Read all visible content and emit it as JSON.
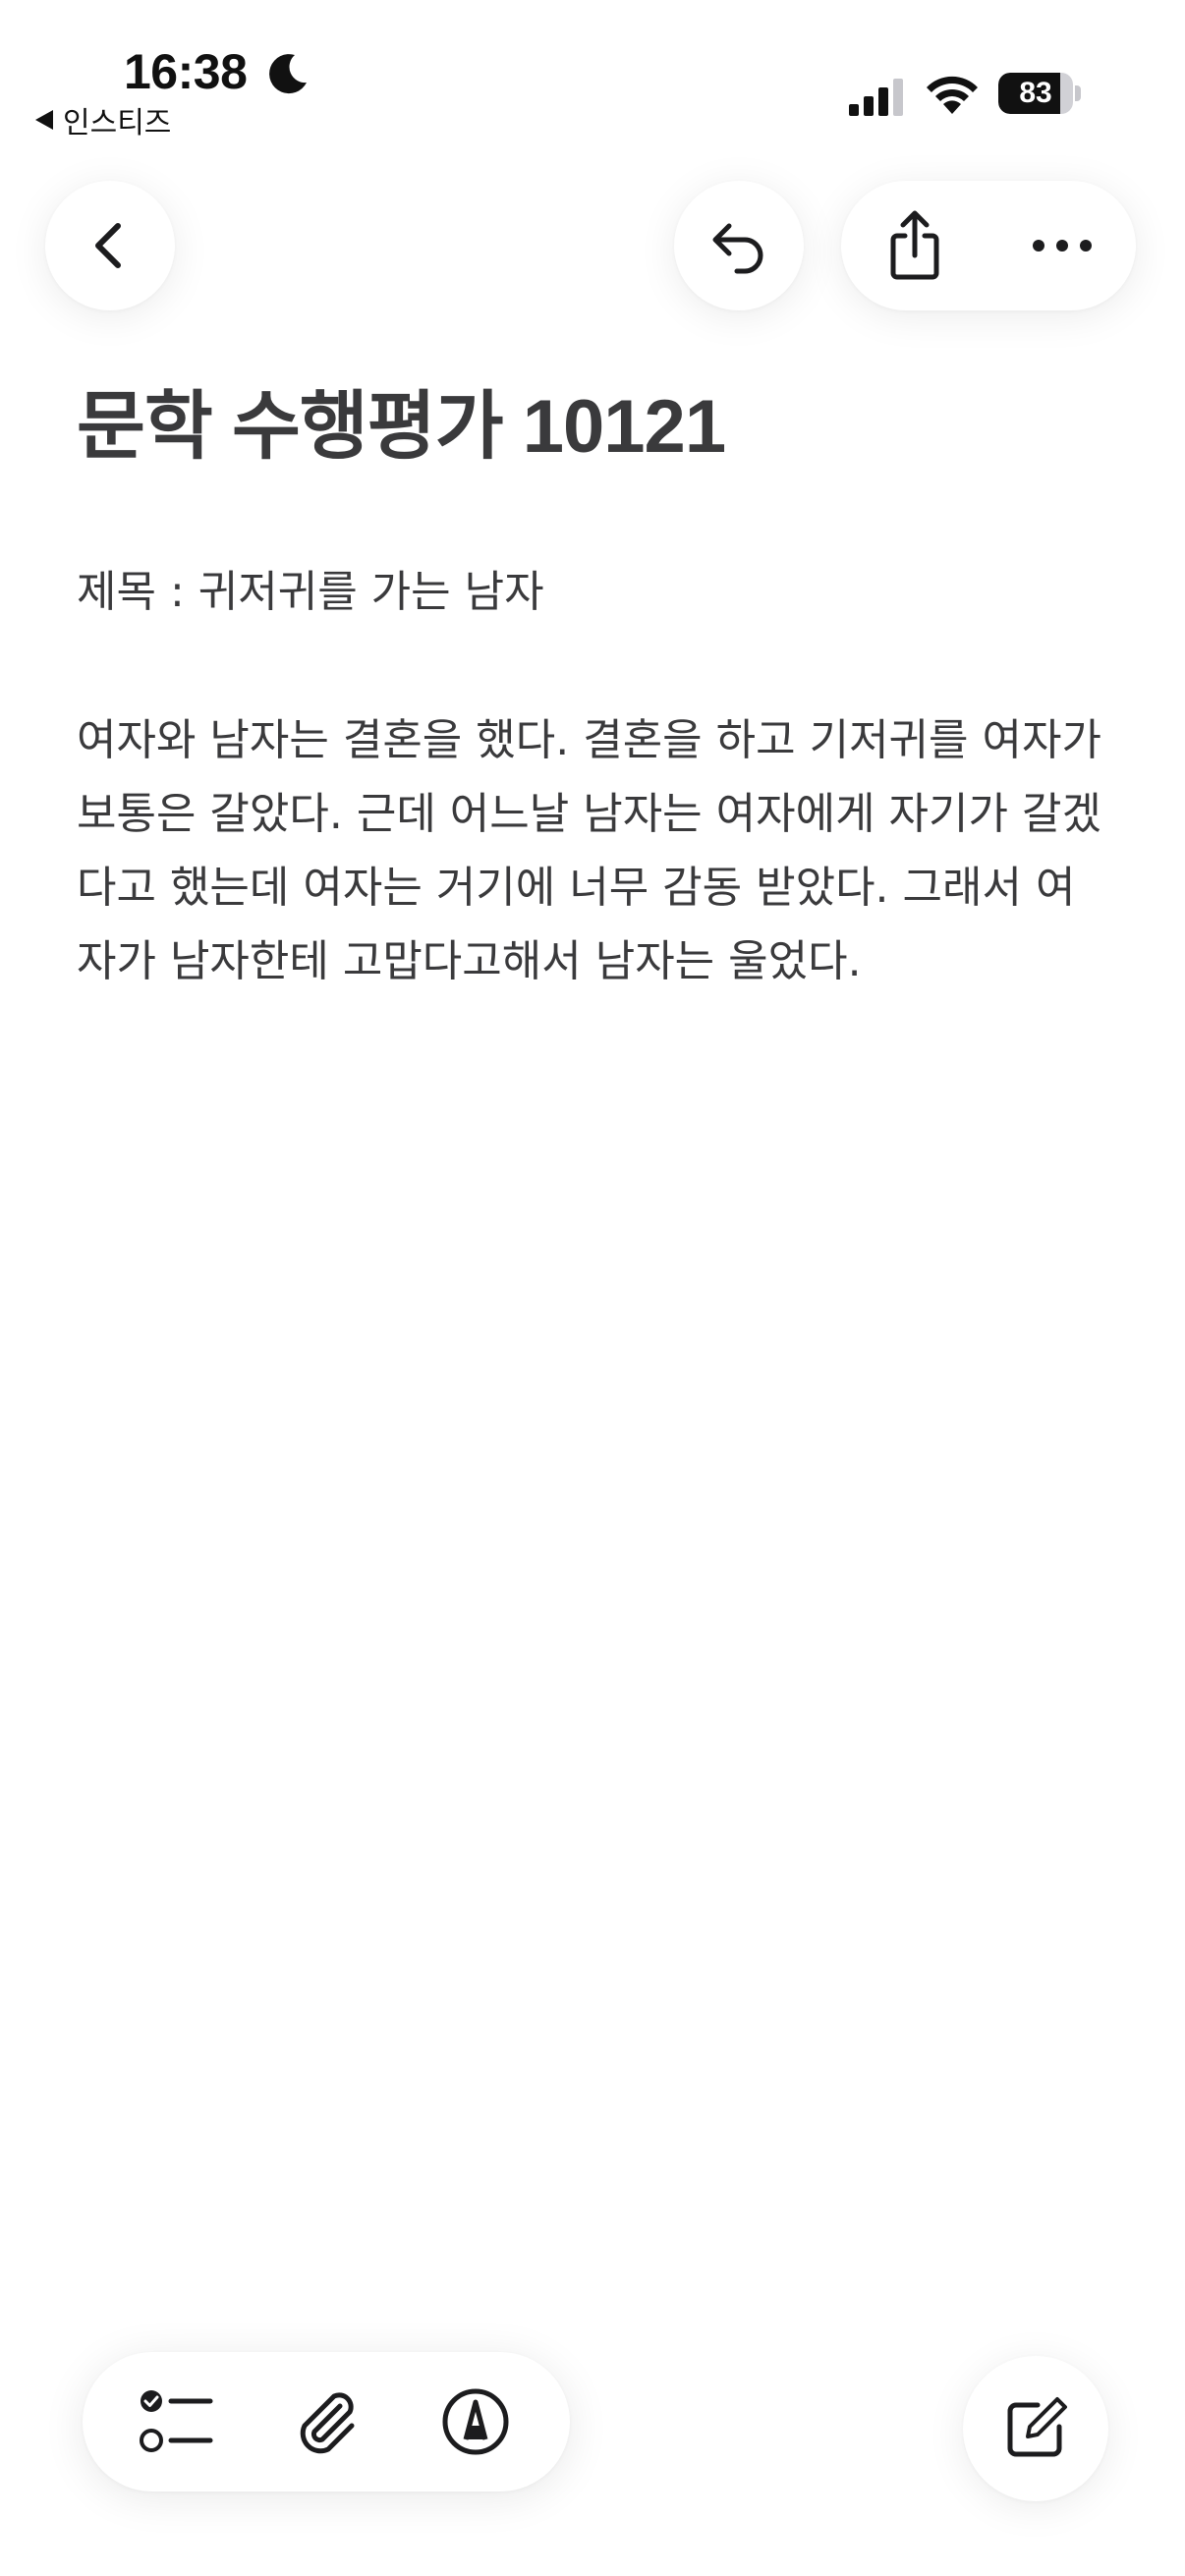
{
  "status_bar": {
    "time": "16:38",
    "focus_icon": "moon-icon",
    "back_app_label": "인스티즈",
    "signal_icon": "cellular-signal-icon",
    "wifi_icon": "wifi-icon",
    "battery_level": "83",
    "battery_fraction": 0.83
  },
  "toolbar": {
    "back_icon": "chevron-left-icon",
    "undo_icon": "undo-icon",
    "share_icon": "share-icon",
    "more_icon": "ellipsis-icon"
  },
  "note": {
    "title": "문학 수행평가 10121",
    "subtitle": "제목 : 귀저귀를 가는 남자",
    "body": "여자와 남자는 결혼을 했다. 결혼을 하고 기저귀를 여자가 보통은 갈았다. 근데 어느날 남자는 여자에게 자기가 갈겠다고 했는데 여자는 거기에 너무 감동 받았다. 그래서 여자가 남자한테 고맙다고해서 남자는 울었다."
  },
  "bottom_toolbar": {
    "checklist_icon": "checklist-icon",
    "attach_icon": "paperclip-icon",
    "markup_icon": "markup-pen-icon",
    "compose_icon": "compose-icon"
  },
  "colors": {
    "background": "#ffffff",
    "text": "#3a3a3c",
    "icon": "#1c1c1e"
  }
}
